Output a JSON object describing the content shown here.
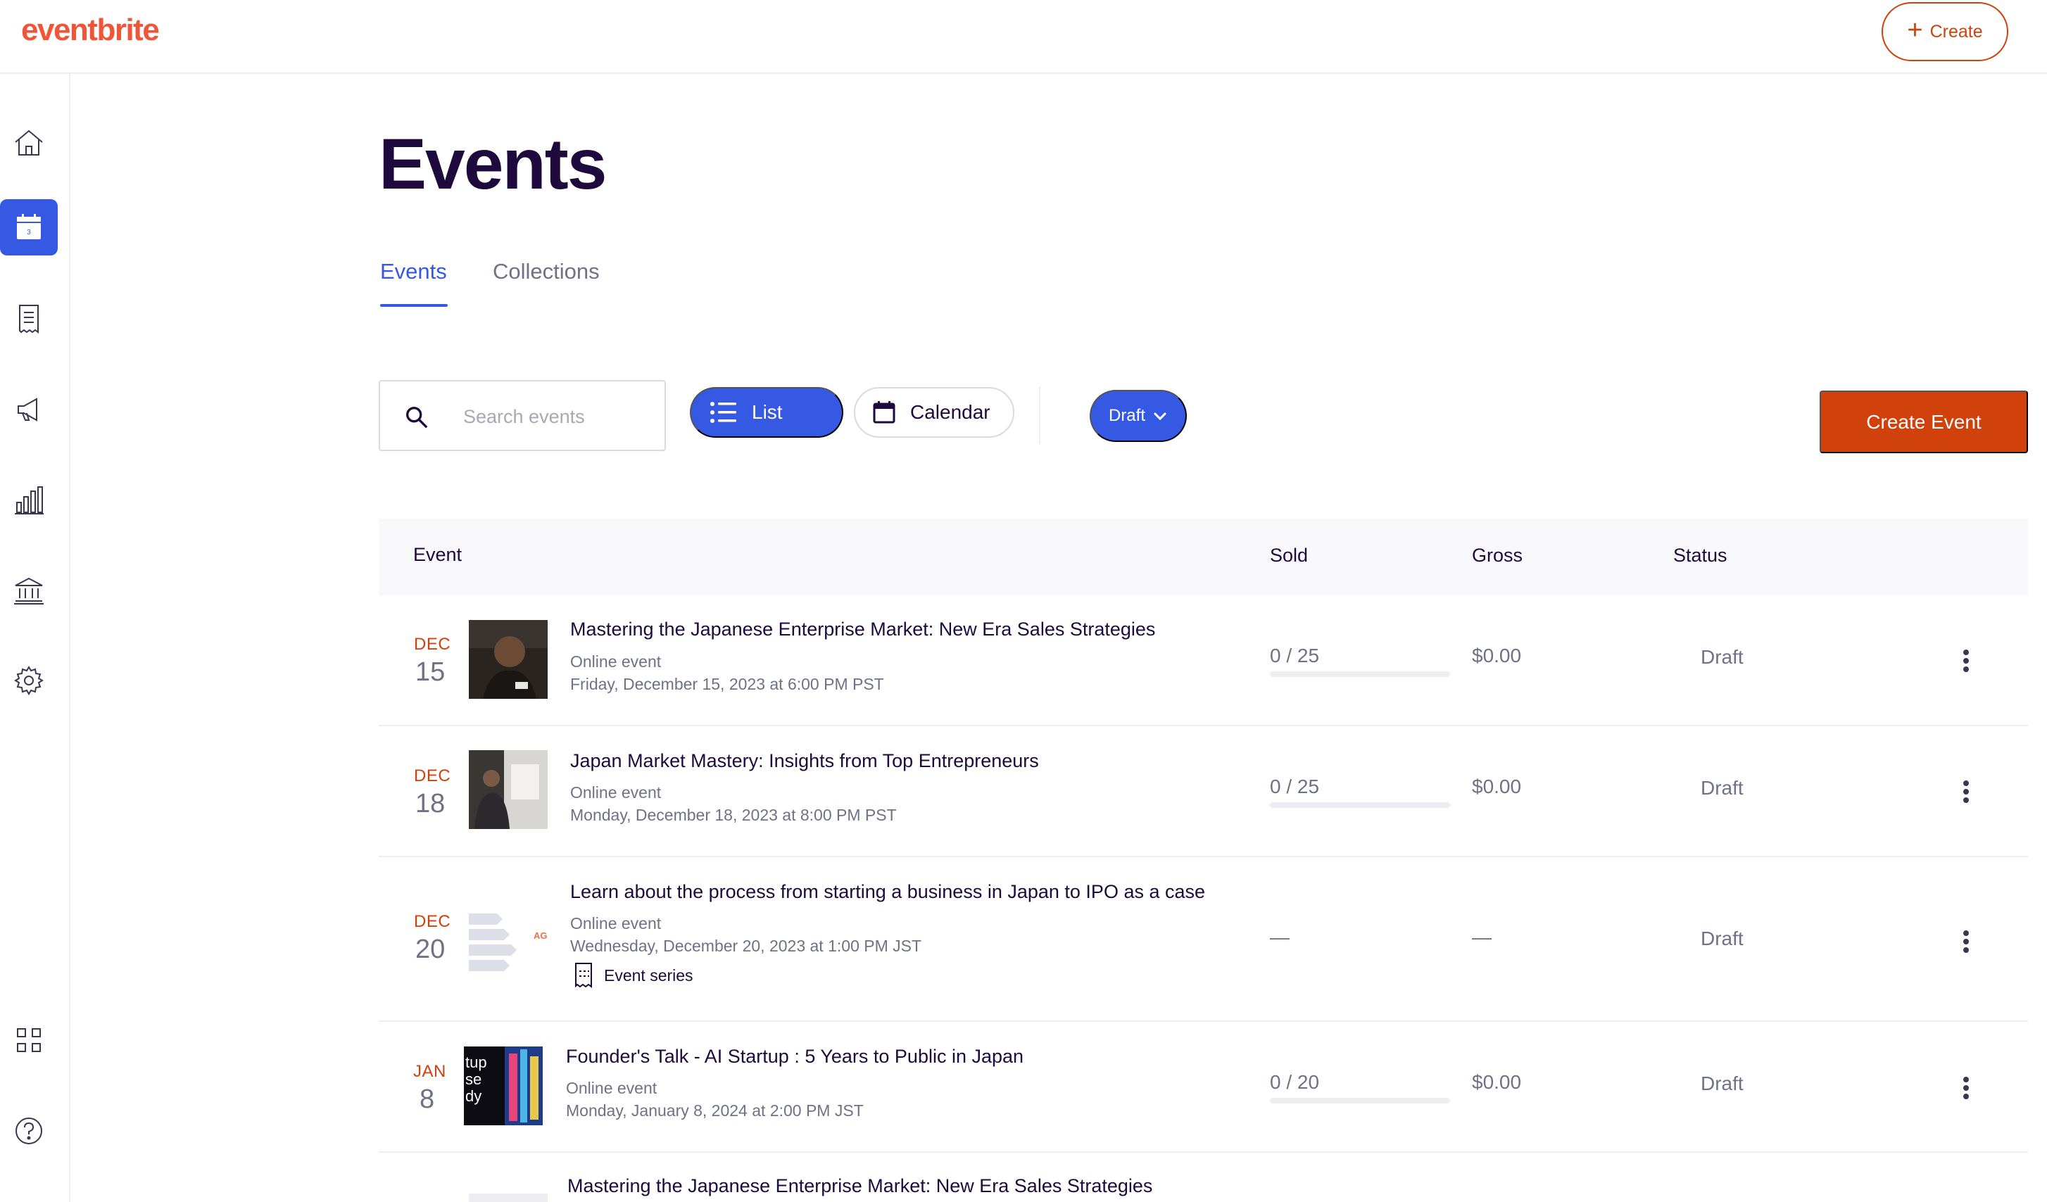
{
  "app": {
    "logo": "eventbrite",
    "create_label": "Create"
  },
  "sidebar": {
    "items": [
      {
        "icon": "home-icon",
        "active": false
      },
      {
        "icon": "calendar-icon",
        "active": true
      },
      {
        "icon": "orders-icon",
        "active": false
      },
      {
        "icon": "megaphone-icon",
        "active": false
      },
      {
        "icon": "reports-icon",
        "active": false
      },
      {
        "icon": "finance-icon",
        "active": false
      },
      {
        "icon": "gear-icon",
        "active": false
      },
      {
        "icon": "apps-grid-icon",
        "active": false
      },
      {
        "icon": "help-icon",
        "active": false
      }
    ],
    "calendar_day": "3"
  },
  "page": {
    "title": "Events"
  },
  "tabs": [
    {
      "label": "Events",
      "active": true
    },
    {
      "label": "Collections",
      "active": false
    }
  ],
  "toolbar": {
    "search_placeholder": "Search events",
    "list_label": "List",
    "calendar_label": "Calendar",
    "filter_label": "Draft",
    "create_event_label": "Create Event"
  },
  "table": {
    "columns": [
      "Event",
      "Sold",
      "Gross",
      "Status"
    ],
    "rows": [
      {
        "month": "DEC",
        "day": "15",
        "title": "Mastering the Japanese Enterprise Market: New Era Sales Strategies",
        "location": "Online event",
        "datetime": "Friday, December 15, 2023 at 6:00 PM PST",
        "sold": "0 / 25",
        "sold_fraction": 0,
        "gross": "$0.00",
        "status": "Draft"
      },
      {
        "month": "DEC",
        "day": "18",
        "title": "Japan Market Mastery: Insights from Top Entrepreneurs",
        "location": "Online event",
        "datetime": "Monday, December 18, 2023 at 8:00 PM PST",
        "sold": "0 / 25",
        "sold_fraction": 0,
        "gross": "$0.00",
        "status": "Draft"
      },
      {
        "month": "DEC",
        "day": "20",
        "title": "Learn about the process from starting a business in Japan to IPO as a case",
        "location": "Online event",
        "datetime": "Wednesday, December 20, 2023 at 1:00 PM JST",
        "series_label": "Event series",
        "thumb_text": "AG",
        "sold": "—",
        "gross": "—",
        "status": "Draft"
      },
      {
        "month": "JAN",
        "day": "8",
        "title": "Founder's Talk - AI Startup : 5 Years to Public in Japan",
        "location": "Online event",
        "datetime": "Monday, January 8, 2024 at 2:00 PM JST",
        "thumb_lines": [
          "tup",
          "se",
          "dy"
        ],
        "sold": "0 / 20",
        "sold_fraction": 0,
        "gross": "$0.00",
        "status": "Draft"
      },
      {
        "title": "Mastering the Japanese Enterprise Market: New Era Sales Strategies"
      }
    ]
  },
  "colors": {
    "brand_orange": "#f05537",
    "accent_blue": "#3659e3",
    "cta_orange": "#d1410c",
    "text_dark": "#1e0a3c",
    "text_muted": "#6f7287"
  }
}
